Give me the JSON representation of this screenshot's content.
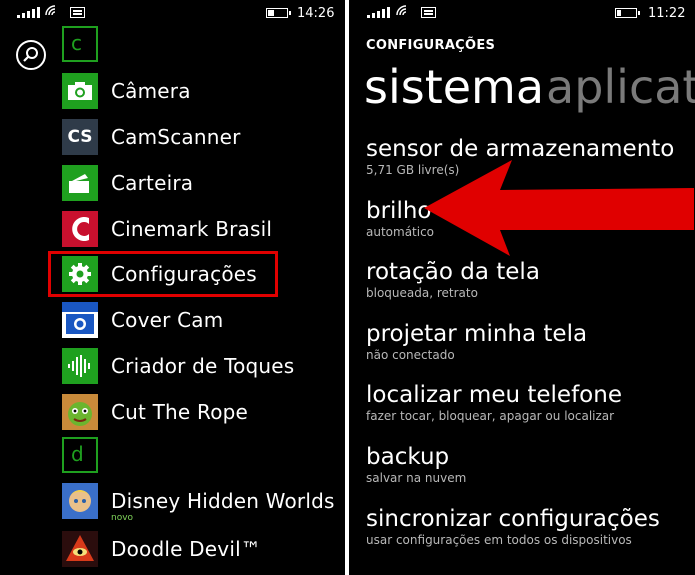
{
  "left_screen": {
    "status": {
      "time": "14:26"
    },
    "groups": [
      {
        "letter": "c"
      },
      {
        "letter": "d"
      }
    ],
    "apps": [
      {
        "name": "Câmera",
        "icon": "camera-icon",
        "color": "#1fa01f"
      },
      {
        "name": "CamScanner",
        "icon": "camscanner-icon",
        "icon_text": "CS",
        "color": "#2f3b49"
      },
      {
        "name": "Carteira",
        "icon": "wallet-icon",
        "color": "#1fa01f"
      },
      {
        "name": "Cinemark Brasil",
        "icon": "cinemark-icon",
        "color": "#c8102e"
      },
      {
        "name": "Configurações",
        "icon": "gear-icon",
        "color": "#1fa01f"
      },
      {
        "name": "Cover Cam",
        "icon": "covercam-icon",
        "color": "#1a57c2"
      },
      {
        "name": "Criador de Toques",
        "icon": "ringtone-icon",
        "color": "#1fa01f"
      },
      {
        "name": "Cut The Rope",
        "icon": "cut-the-rope-icon",
        "color": "#2d7a2b"
      },
      {
        "name": "Disney Hidden Worlds",
        "icon": "disney-icon",
        "color": "#6a3fa0"
      },
      {
        "name": "Doodle Devil™",
        "icon": "doodle-devil-icon",
        "color": "#b3261e"
      }
    ],
    "new_badge": "novo"
  },
  "right_screen": {
    "status": {
      "time": "11:22"
    },
    "caption": "CONFIGURAÇÕES",
    "pivot_title": "sistema",
    "pivot_next": "aplicati",
    "settings": [
      {
        "title": "sensor de armazenamento",
        "subtitle": "5,71 GB livre(s)"
      },
      {
        "title": "brilho",
        "subtitle": "automático"
      },
      {
        "title": "rotação da tela",
        "subtitle": "bloqueada, retrato"
      },
      {
        "title": "projetar minha tela",
        "subtitle": "não conectado"
      },
      {
        "title": "localizar meu telefone",
        "subtitle": "fazer tocar, bloquear, apagar ou localizar"
      },
      {
        "title": "backup",
        "subtitle": "salvar na nuvem"
      },
      {
        "title": "sincronizar configurações",
        "subtitle": "usar configurações em todos os dispositivos"
      }
    ]
  },
  "annotations": {
    "highlight_color": "#e00000",
    "arrow_color": "#e00000"
  }
}
